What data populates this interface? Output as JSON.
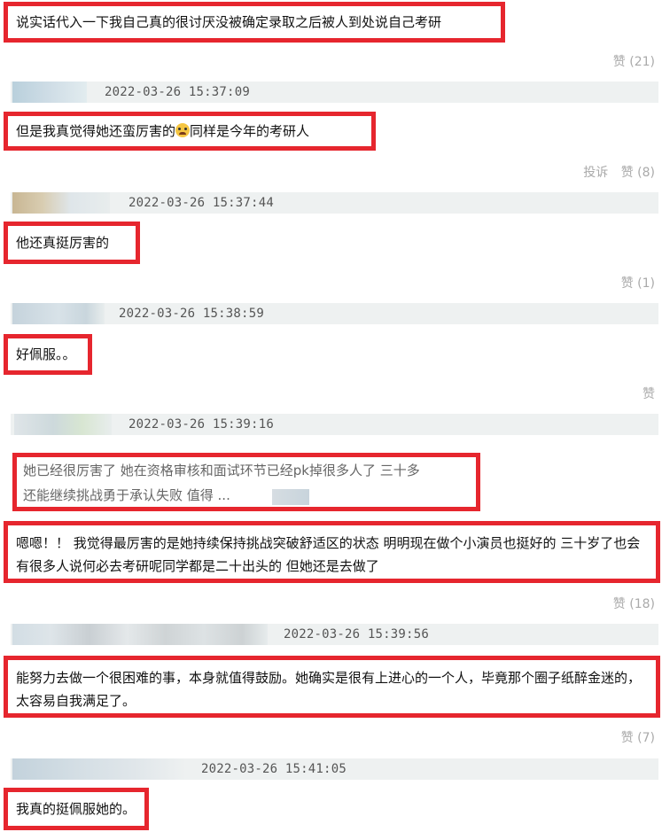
{
  "comments": [
    {
      "text": "说实话代入一下我自己真的很讨厌没被确定录取之后被人到处说自己考研",
      "actions": [
        "赞 (21)"
      ],
      "timestamp": "2022-03-26 15:37:09"
    },
    {
      "text_before_emoji": "但是我真觉得她还蛮厉害的",
      "emoji_icon": "crying-face-icon",
      "text_after_emoji": "同样是今年的考研人",
      "actions": [
        "投诉",
        "赞 (8)"
      ],
      "timestamp": "2022-03-26 15:37:44"
    },
    {
      "text": "他还真挺厉害的",
      "actions": [
        "赞 (1)"
      ],
      "timestamp": "2022-03-26 15:38:59"
    },
    {
      "text": "好佩服。。",
      "actions": [
        "赞"
      ],
      "timestamp": "2022-03-26 15:39:16"
    },
    {
      "quote_line1": "她已经很厉害了 她在资格审核和面试环节已经pk掉很多人了 三十多",
      "quote_line2": "还能继续挑战勇于承认失败 值得 ..."
    },
    {
      "text": "嗯嗯！！ 我觉得最厉害的是她持续保持挑战突破舒适区的状态 明明现在做个小演员也挺好的 三十岁了也会有很多人说何必去考研呢同学都是二十出头的 但她还是去做了",
      "actions": [
        "赞 (18)"
      ],
      "timestamp": "2022-03-26 15:39:56"
    },
    {
      "text": "能努力去做一个很困难的事，本身就值得鼓励。她确实是很有上进心的一个人，毕竟那个圈子纸醉金迷的，太容易自我满足了。",
      "actions": [
        "赞 (7)"
      ],
      "timestamp": "2022-03-26 15:41:05"
    },
    {
      "text": "我真的挺佩服她的。"
    }
  ],
  "colors": {
    "highlight_border": "#e6262e",
    "meta_bar": "#eef1f1",
    "action_text": "#aaaaaa"
  }
}
